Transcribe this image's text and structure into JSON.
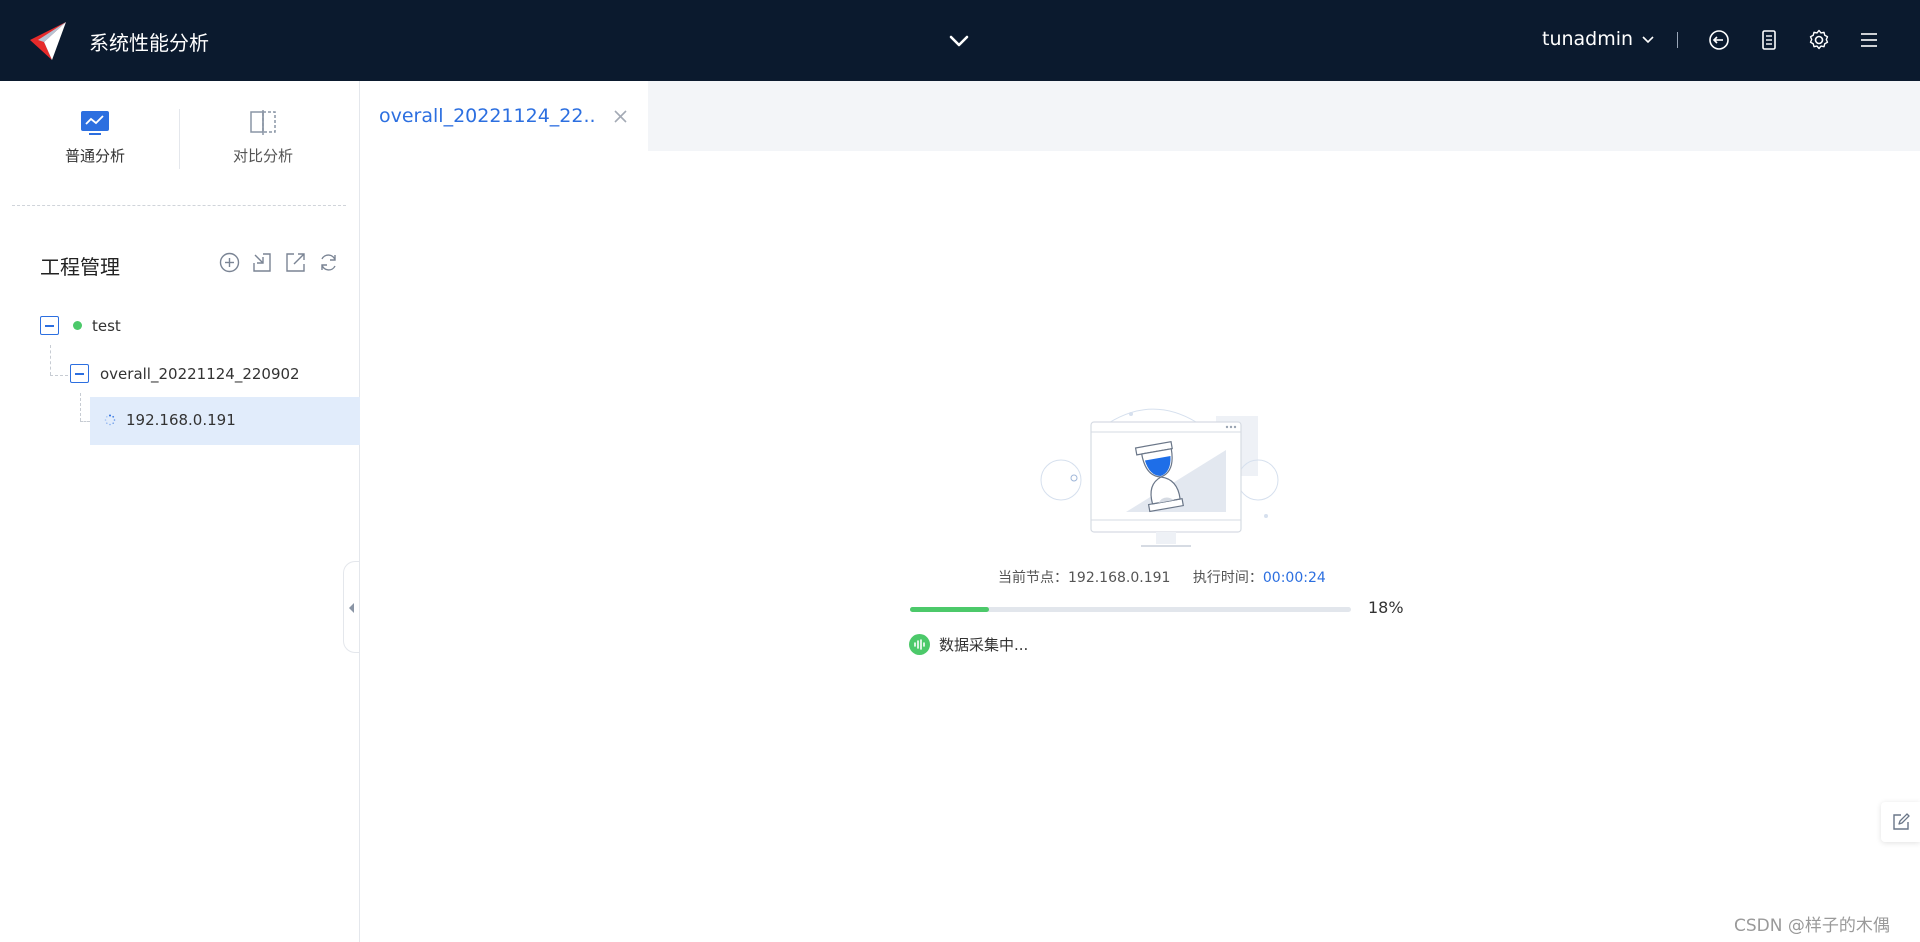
{
  "header": {
    "app_title": "系统性能分析",
    "username": "tunadmin",
    "icons": [
      "chevron-down-icon",
      "logout-icon",
      "server-icon",
      "gear-icon",
      "menu-icon"
    ]
  },
  "sidebar": {
    "modes": [
      {
        "label": "普通分析",
        "icon": "monitor-chart-icon",
        "active": true
      },
      {
        "label": "对比分析",
        "icon": "compare-icon",
        "active": false
      }
    ],
    "section_title": "工程管理",
    "section_actions": [
      "add-circle-icon",
      "import-icon",
      "export-icon",
      "refresh-icon"
    ],
    "tree": {
      "project": {
        "label": "test",
        "status_color": "#4cc96a"
      },
      "task": {
        "label": "overall_20221124_220902"
      },
      "node": {
        "label": "192.168.0.191",
        "icon": "loading-spinner-icon"
      }
    }
  },
  "tabs": [
    {
      "label": "overall_20221124_22...",
      "active": true
    }
  ],
  "progress": {
    "node_label": "当前节点：",
    "node_value": "192.168.0.191",
    "time_label": "执行时间：",
    "time_value": "00:00:24",
    "percent_value": 18,
    "percent_text": "18%",
    "status_text": "数据采集中..."
  },
  "colors": {
    "header_bg": "#0b1a2e",
    "accent": "#2c6fe0",
    "success": "#4cc96a",
    "selected_bg": "#e1ecfb"
  },
  "watermark": "CSDN @样子的木偶"
}
